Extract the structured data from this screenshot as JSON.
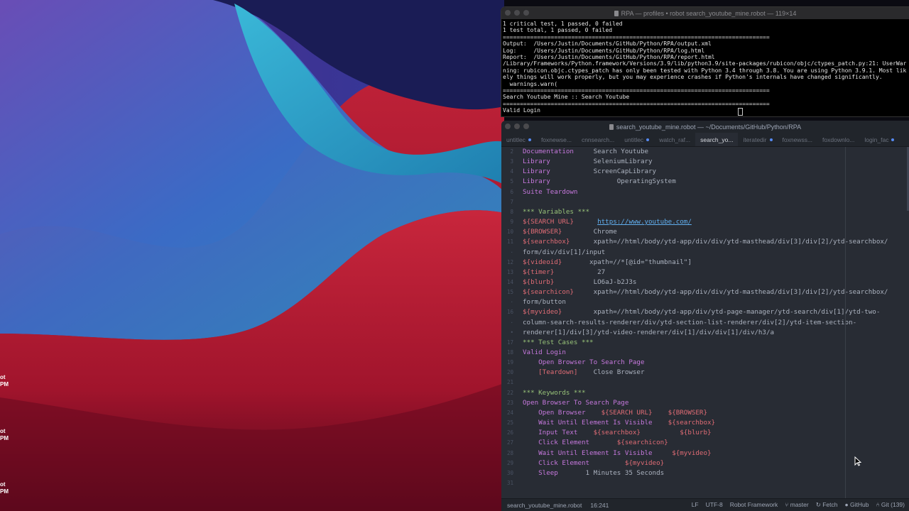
{
  "desktop": {
    "labels": [
      {
        "line1": "ot",
        "line2": "PM"
      },
      {
        "line1": "ot",
        "line2": "PM"
      },
      {
        "line1": "ot",
        "line2": "PM"
      }
    ]
  },
  "terminal": {
    "title": "RPA — profiles • robot search_youtube_mine.robot — 119×14",
    "lines": [
      "1 critical test, 1 passed, 0 failed",
      "1 test total, 1 passed, 0 failed",
      "==============================================================================",
      "Output:  /Users/Justin/Documents/GitHub/Python/RPA/output.xml",
      "Log:     /Users/Justin/Documents/GitHub/Python/RPA/log.html",
      "Report:  /Users/Justin/Documents/GitHub/Python/RPA/report.html",
      "/Library/Frameworks/Python.framework/Versions/3.9/lib/python3.9/site-packages/rubicon/objc/ctypes_patch.py:21: UserWarning: rubicon.objc.ctypes_patch has only been tested with Python 3.4 through 3.8. You are using Python 3.9.1. Most likely things will work properly, but you may experience crashes if Python's internals have changed significantly.",
      "  warnings.warn(",
      "==============================================================================",
      "Search Youtube Mine :: Search Youtube",
      "==============================================================================",
      "Valid Login"
    ]
  },
  "editor": {
    "title": "search_youtube_mine.robot — ~/Documents/GitHub/Python/RPA",
    "tabs": [
      {
        "label": "untitlec",
        "modified": true
      },
      {
        "label": "foxnewse...",
        "modified": false
      },
      {
        "label": "cnnsearch...",
        "modified": false
      },
      {
        "label": "untitlec",
        "modified": true
      },
      {
        "label": "watch_raf...",
        "modified": false
      },
      {
        "label": "search_yo...",
        "modified": false,
        "active": true
      },
      {
        "label": "iteratedir",
        "modified": true
      },
      {
        "label": "foxnewss...",
        "modified": false
      },
      {
        "label": "foxdownlo...",
        "modified": false
      },
      {
        "label": "login_fac",
        "modified": true
      }
    ],
    "lines": [
      {
        "n": "2",
        "segs": [
          {
            "c": "key",
            "t": "Documentation     "
          },
          {
            "c": "plain",
            "t": "Search Youtube"
          }
        ]
      },
      {
        "n": "3",
        "segs": [
          {
            "c": "key",
            "t": "Library           "
          },
          {
            "c": "plain",
            "t": "SeleniumLibrary"
          }
        ]
      },
      {
        "n": "4",
        "segs": [
          {
            "c": "key",
            "t": "Library           "
          },
          {
            "c": "plain",
            "t": "ScreenCapLibrary"
          }
        ]
      },
      {
        "n": "5",
        "segs": [
          {
            "c": "key",
            "t": "Library                 "
          },
          {
            "c": "plain",
            "t": "OperatingSystem"
          }
        ]
      },
      {
        "n": "6",
        "segs": [
          {
            "c": "key",
            "t": "Suite Teardown"
          }
        ]
      },
      {
        "n": "7",
        "segs": []
      },
      {
        "n": "8",
        "segs": [
          {
            "c": "sec",
            "t": "*** Variables ***"
          }
        ]
      },
      {
        "n": "9",
        "segs": [
          {
            "c": "var",
            "t": "${SEARCH URL}      "
          },
          {
            "c": "url",
            "t": "https://www.youtube.com/"
          }
        ]
      },
      {
        "n": "10",
        "segs": [
          {
            "c": "var",
            "t": "${BROWSER}        "
          },
          {
            "c": "plain",
            "t": "Chrome"
          }
        ]
      },
      {
        "n": "11",
        "segs": [
          {
            "c": "var",
            "t": "${searchbox}      "
          },
          {
            "c": "plain",
            "t": "xpath=//html/body/ytd-app/div/div/ytd-masthead/div[3]/div[2]/ytd-searchbox/"
          }
        ]
      },
      {
        "n": "·",
        "segs": [
          {
            "c": "plain",
            "t": "form/div/div[1]/input"
          }
        ]
      },
      {
        "n": "12",
        "segs": [
          {
            "c": "var",
            "t": "${videoid}       "
          },
          {
            "c": "plain",
            "t": "xpath=//*[@id=\"thumbnail\"]"
          }
        ]
      },
      {
        "n": "13",
        "segs": [
          {
            "c": "var",
            "t": "${timer}           "
          },
          {
            "c": "plain",
            "t": "27"
          }
        ]
      },
      {
        "n": "14",
        "segs": [
          {
            "c": "var",
            "t": "${blurb}          "
          },
          {
            "c": "plain",
            "t": "LO6aJ-b2J3s"
          }
        ]
      },
      {
        "n": "15",
        "segs": [
          {
            "c": "var",
            "t": "${searchicon}     "
          },
          {
            "c": "plain",
            "t": "xpath=//html/body/ytd-app/div/div/ytd-masthead/div[3]/div[2]/ytd-searchbox/"
          }
        ]
      },
      {
        "n": "·",
        "segs": [
          {
            "c": "plain",
            "t": "form/button"
          }
        ]
      },
      {
        "n": "16",
        "segs": [
          {
            "c": "var",
            "t": "${myvideo}        "
          },
          {
            "c": "plain",
            "t": "xpath=//html/body/ytd-app/div/ytd-page-manager/ytd-search/div[1]/ytd-two-"
          }
        ]
      },
      {
        "n": "·",
        "segs": [
          {
            "c": "plain",
            "t": "column-search-results-renderer/div/ytd-section-list-renderer/div[2]/ytd-item-section-"
          }
        ]
      },
      {
        "n": "•",
        "segs": [
          {
            "c": "plain",
            "t": "renderer[1]/div[3]/ytd-video-renderer/div[1]/div/div[1]/div/h3/a"
          }
        ]
      },
      {
        "n": "17",
        "segs": [
          {
            "c": "sec",
            "t": "*** Test Cases ***"
          }
        ]
      },
      {
        "n": "18",
        "segs": [
          {
            "c": "key",
            "t": "Valid Login"
          }
        ]
      },
      {
        "n": "19",
        "segs": [
          {
            "c": "key",
            "t": "    Open Browser To Search Page"
          }
        ]
      },
      {
        "n": "20",
        "segs": [
          {
            "c": "var",
            "t": "    [Teardown]    "
          },
          {
            "c": "plain",
            "t": "Close Browser"
          }
        ]
      },
      {
        "n": "21",
        "segs": []
      },
      {
        "n": "22",
        "segs": [
          {
            "c": "sec",
            "t": "*** Keywords ***"
          }
        ]
      },
      {
        "n": "23",
        "segs": [
          {
            "c": "key",
            "t": "Open Browser To Search Page"
          }
        ]
      },
      {
        "n": "24",
        "segs": [
          {
            "c": "key",
            "t": "    Open Browser    "
          },
          {
            "c": "var",
            "t": "${SEARCH URL}    ${BROWSER}"
          }
        ]
      },
      {
        "n": "25",
        "segs": [
          {
            "c": "key",
            "t": "    Wait Until Element Is Visible    "
          },
          {
            "c": "var",
            "t": "${searchbox}"
          }
        ]
      },
      {
        "n": "26",
        "segs": [
          {
            "c": "key",
            "t": "    Input Text    "
          },
          {
            "c": "var",
            "t": "${searchbox}          ${blurb}"
          }
        ]
      },
      {
        "n": "27",
        "segs": [
          {
            "c": "key",
            "t": "    Click Element       "
          },
          {
            "c": "var",
            "t": "${searchicon}"
          }
        ]
      },
      {
        "n": "28",
        "segs": [
          {
            "c": "key",
            "t": "    Wait Until Element Is Visible     "
          },
          {
            "c": "var",
            "t": "${myvideo}"
          }
        ]
      },
      {
        "n": "29",
        "segs": [
          {
            "c": "key",
            "t": "    Click Element         "
          },
          {
            "c": "var",
            "t": "${myvideo}"
          }
        ]
      },
      {
        "n": "30",
        "segs": [
          {
            "c": "key",
            "t": "    Sleep       "
          },
          {
            "c": "plain",
            "t": "1 Minutes 35 Seconds"
          }
        ]
      },
      {
        "n": "31",
        "segs": []
      }
    ],
    "status": {
      "file": "search_youtube_mine.robot",
      "cursor": "16:241",
      "line_ending": "LF",
      "encoding": "UTF-8",
      "grammar": "Robot Framework",
      "branch": "master",
      "fetch": "Fetch",
      "github": "GitHub",
      "git": "Git (139)"
    }
  },
  "colors": {
    "editor_bg": "#282c34",
    "keyword": "#c678dd",
    "variable": "#e06c75",
    "section": "#98c379",
    "link": "#61afef"
  }
}
